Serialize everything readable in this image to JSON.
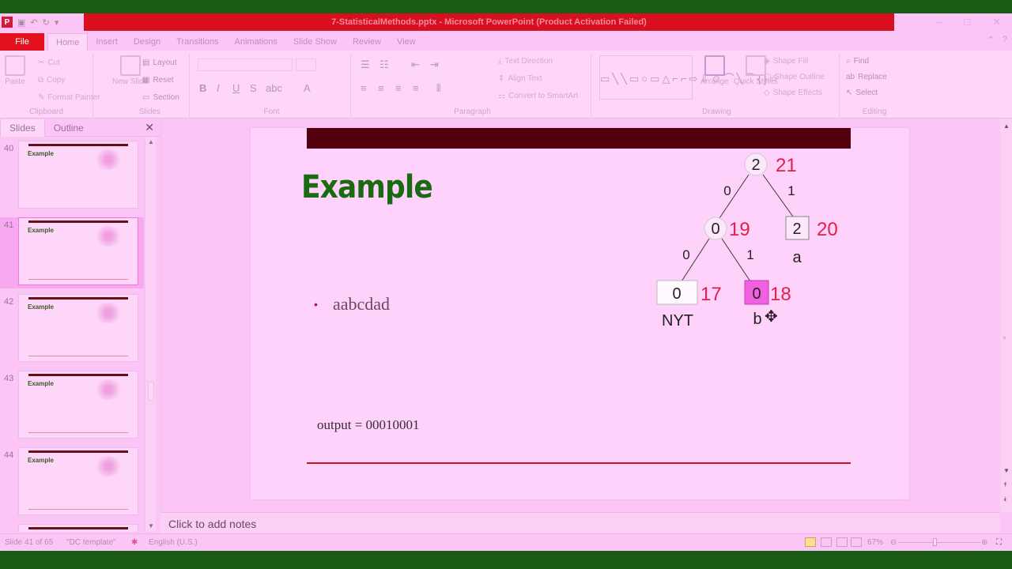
{
  "titlebar": {
    "title": "7-StatisticalMethods.pptx - Microsoft PowerPoint (Product Activation Failed)",
    "minimize_icon": "minimize-icon",
    "maximize_icon": "maximize-icon",
    "close_icon": "close-icon"
  },
  "tabs": [
    "File",
    "Home",
    "Insert",
    "Design",
    "Transitions",
    "Animations",
    "Slide Show",
    "Review",
    "View"
  ],
  "active_tab": "Home",
  "ribbon": {
    "clipboard": {
      "label": "Clipboard",
      "paste": "Paste",
      "cut": "Cut",
      "copy": "Copy",
      "format_painter": "Format Painter"
    },
    "slides": {
      "label": "Slides",
      "new_slide": "New Slide",
      "layout": "Layout",
      "reset": "Reset",
      "section": "Section"
    },
    "font": {
      "label": "Font"
    },
    "paragraph": {
      "label": "Paragraph",
      "text_direction": "Text Direction",
      "align_text": "Align Text",
      "convert": "Convert to SmartArt"
    },
    "drawing": {
      "label": "Drawing",
      "arrange": "Arrange",
      "quick_styles": "Quick Styles",
      "shape_fill": "Shape Fill",
      "shape_outline": "Shape Outline",
      "shape_effects": "Shape Effects"
    },
    "editing": {
      "label": "Editing",
      "find": "Find",
      "replace": "Replace",
      "select": "Select"
    }
  },
  "panel": {
    "tab_slides": "Slides",
    "tab_outline": "Outline",
    "thumbnails": [
      {
        "num": "40",
        "title": "Example"
      },
      {
        "num": "41",
        "title": "Example"
      },
      {
        "num": "42",
        "title": "Example"
      },
      {
        "num": "43",
        "title": "Example"
      },
      {
        "num": "44",
        "title": "Example"
      }
    ],
    "selected_slide": "41"
  },
  "slide": {
    "title": "Example",
    "bullet": "aabcdad",
    "output": "output = 00010001",
    "tree": {
      "root": {
        "node": "2",
        "number": "21"
      },
      "edge_root_left": "0",
      "edge_root_right": "1",
      "internal": {
        "node": "0",
        "number": "19"
      },
      "leaf_a": {
        "node": "2",
        "number": "20",
        "symbol": "a"
      },
      "edge_int_left": "0",
      "edge_int_right": "1",
      "nyt": {
        "node": "0",
        "number": "17",
        "symbol": "NYT"
      },
      "leaf_b": {
        "node": "0",
        "number": "18",
        "symbol": "b"
      }
    },
    "colors": {
      "title": "#1a6a12",
      "numbers": "#e0204a",
      "highlight": "#f060e0",
      "bar": "#54000c"
    }
  },
  "notes": {
    "placeholder": "Click to add notes"
  },
  "status": {
    "slide_info": "Slide 41 of 65",
    "template": "\"DC template\"",
    "language": "English (U.S.)",
    "zoom": "67%"
  }
}
